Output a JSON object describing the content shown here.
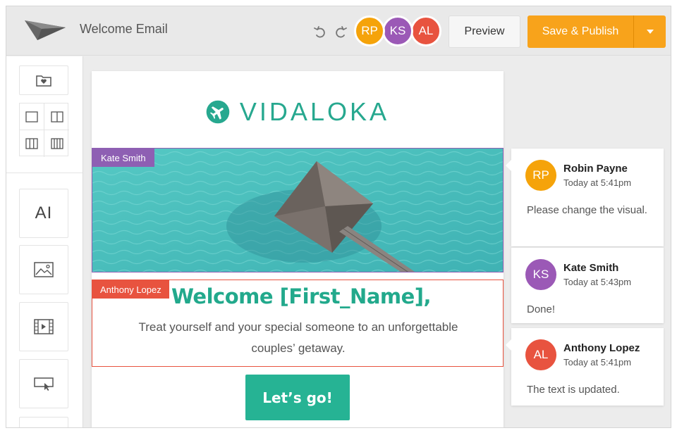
{
  "header": {
    "document_title": "Welcome Email",
    "collaborators": [
      {
        "initials": "RP",
        "color": "#f5a30a"
      },
      {
        "initials": "KS",
        "color": "#9b59b6"
      },
      {
        "initials": "AL",
        "color": "#e8533f"
      }
    ],
    "preview_label": "Preview",
    "publish_label": "Save & Publish",
    "accent_color": "#f8a31b"
  },
  "sidebar": {
    "tools": [
      "folder-icon",
      "one-column-layout-icon",
      "two-column-layout-icon",
      "three-column-layout-icon",
      "four-column-layout-icon",
      "text-tool-icon",
      "image-icon",
      "video-icon",
      "button-icon"
    ],
    "text_tool_label": "AI"
  },
  "email": {
    "brand_name": "VIDALOKA",
    "brand_color": "#27a88f",
    "hero_editor_tag": "Kate Smith",
    "text_editor_tag": "Anthony Lopez",
    "heading": "Welcome [First_Name],",
    "body": "Treat yourself and your special someone to an unforgettable couples’ getaway.",
    "cta_label": "Let’s go!"
  },
  "comments": [
    {
      "initials": "RP",
      "name": "Robin Payne",
      "time": "Today at 5:41pm",
      "text": "Please change the visual.",
      "color": "#f5a30a"
    },
    {
      "initials": "KS",
      "name": "Kate Smith",
      "time": "Today at 5:43pm",
      "text": "Done!",
      "color": "#9b59b6"
    },
    {
      "initials": "AL",
      "name": "Anthony Lopez",
      "time": "Today at 5:41pm",
      "text": "The text is updated.",
      "color": "#e8533f"
    }
  ]
}
